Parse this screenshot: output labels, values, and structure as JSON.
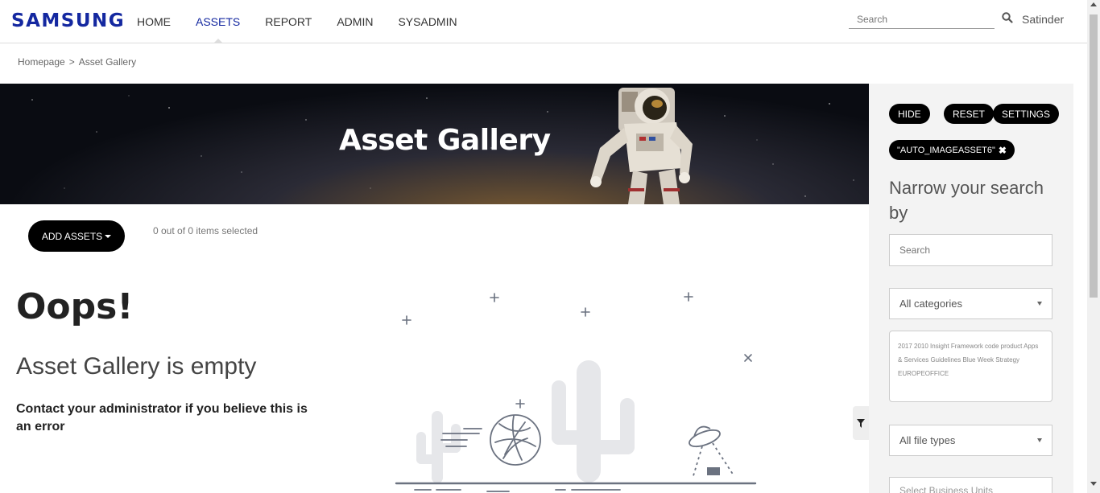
{
  "brand": {
    "logo_text": "SAMSUNG",
    "color": "#1428a0"
  },
  "nav": {
    "items": [
      {
        "label": "HOME",
        "active": false
      },
      {
        "label": "ASSETS",
        "active": true
      },
      {
        "label": "REPORT",
        "active": false
      },
      {
        "label": "ADMIN",
        "active": false
      },
      {
        "label": "SYSADMIN",
        "active": false
      }
    ]
  },
  "header": {
    "search_placeholder": "Search",
    "search_icon": "search-icon",
    "user_name": "Satinder"
  },
  "breadcrumb": {
    "items": [
      "Homepage",
      "Asset Gallery"
    ],
    "separator": ">"
  },
  "banner": {
    "title": "Asset Gallery",
    "image": "astronaut-in-space"
  },
  "toolbar": {
    "add_assets_label": "ADD ASSETS",
    "selection_status": "0 out of 0 items selected"
  },
  "empty_state": {
    "heading": "Oops!",
    "title": "Asset Gallery is empty",
    "message": "Contact your administrator if you believe this is an error",
    "illustration": "desert-cactus-ufo"
  },
  "sidebar": {
    "buttons": {
      "hide": "HIDE",
      "reset": "RESET",
      "settings": "SETTINGS"
    },
    "active_filter_tag": "\"AUTO_IMAGEASSET6\"",
    "narrow_title": "Narrow your search by",
    "search_placeholder": "Search",
    "categories_select": "All categories",
    "tag_cloud": "2017 2010 Insight Framework code product Apps & Services Guidelines Blue Week Strategy EUROPEOFFICE",
    "file_types_select": "All file types",
    "business_units_select": "Select Business Units"
  },
  "colors": {
    "accent": "#1428a0",
    "pill_bg": "#000000",
    "sidebar_bg": "#f3f3f3"
  }
}
